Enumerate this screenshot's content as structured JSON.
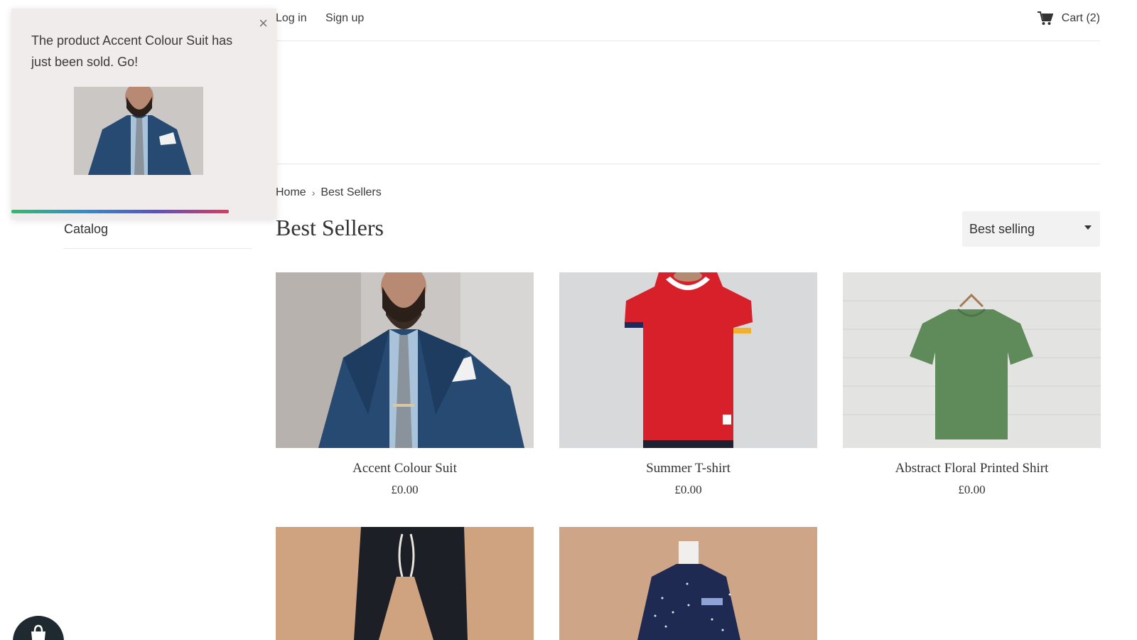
{
  "header": {
    "login_label": "Log in",
    "signup_label": "Sign up",
    "cart_label": "Cart (2)",
    "cart_icon": "cart-icon"
  },
  "sidebar": {
    "catalog_label": "Catalog"
  },
  "breadcrumb": {
    "home": "Home",
    "separator": "›",
    "current": "Best Sellers"
  },
  "page": {
    "title": "Best Sellers",
    "sort_value": "Best selling"
  },
  "products": [
    {
      "name": "Accent Colour Suit",
      "price": "£0.00"
    },
    {
      "name": "Summer T-shirt",
      "price": "£0.00"
    },
    {
      "name": "Abstract Floral Printed Shirt",
      "price": "£0.00"
    },
    {
      "name": "",
      "price": ""
    },
    {
      "name": "",
      "price": ""
    }
  ],
  "popup": {
    "message": "The product Accent Colour Suit has just been sold. Go!",
    "close_label": "×",
    "progress": 0.82
  },
  "colors": {
    "accent_gradient": [
      "#27c16b",
      "#2a8fd6",
      "#5a4fcf",
      "#e8345c"
    ],
    "popup_bg": "#f0eceb"
  }
}
